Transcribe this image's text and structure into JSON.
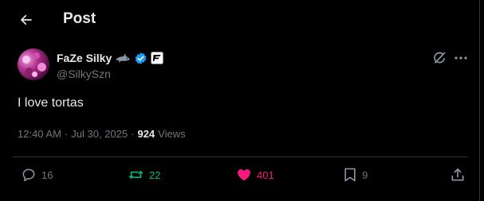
{
  "header": {
    "title": "Post"
  },
  "author": {
    "display_name": "FaZe Silky",
    "handle": "@SilkySzn"
  },
  "tweet": {
    "text": "I love tortas",
    "time": "12:40 AM",
    "date": "Jul 30, 2025",
    "views_count": "924",
    "views_label": "Views"
  },
  "actions": {
    "replies": "16",
    "reposts": "22",
    "likes": "401",
    "bookmarks": "9"
  },
  "colors": {
    "background": "#000000",
    "text_primary": "#e7e9ea",
    "text_secondary": "#71767b",
    "verified": "#1d9bf0",
    "repost": "#00ba7c",
    "like": "#f91880",
    "divider": "#2f3336"
  },
  "icons": {
    "back": "arrow-left-icon",
    "badge": "shark-icon",
    "verified": "verified-badge-icon",
    "affiliate": "faze-logo-icon",
    "grok": "grok-icon",
    "more": "more-icon",
    "reply": "reply-icon",
    "repost": "repost-icon",
    "like": "heart-icon",
    "bookmark": "bookmark-icon",
    "share": "share-icon"
  }
}
